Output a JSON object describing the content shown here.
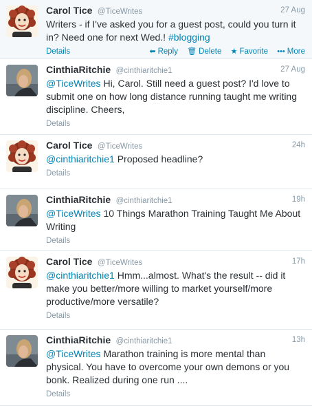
{
  "tweets": [
    {
      "fullname": "Carol Tice",
      "username": "@TiceWrites",
      "time": "27 Aug",
      "text": [
        {
          "t": "Writers - if I've asked you for a guest post, could you turn it in? Need one for next Wed.! "
        },
        {
          "t": "#blogging",
          "k": "hashtag"
        }
      ],
      "details": "Details",
      "actions": {
        "reply": "Reply",
        "delete": "Delete",
        "favorite": "Favorite",
        "more": "More"
      }
    },
    {
      "fullname": "CinthiaRitchie",
      "username": "@cinthiaritchie1",
      "time": "27 Aug",
      "text": [
        {
          "t": "@TiceWrites",
          "k": "mention"
        },
        {
          "t": " Hi, Carol. Still need a guest post? I'd love to submit one on how long distance running taught me writing discipline. Cheers,"
        }
      ],
      "details": "Details"
    },
    {
      "fullname": "Carol Tice",
      "username": "@TiceWrites",
      "time": "24h",
      "text": [
        {
          "t": "@cinthiaritchie1",
          "k": "mention"
        },
        {
          "t": " Proposed headline?"
        }
      ],
      "details": "Details"
    },
    {
      "fullname": "CinthiaRitchie",
      "username": "@cinthiaritchie1",
      "time": "19h",
      "text": [
        {
          "t": "@TiceWrites",
          "k": "mention"
        },
        {
          "t": " 10 Things Marathon Training Taught Me About Writing"
        }
      ],
      "details": "Details"
    },
    {
      "fullname": "Carol Tice",
      "username": "@TiceWrites",
      "time": "17h",
      "text": [
        {
          "t": "@cinthiaritchie1",
          "k": "mention"
        },
        {
          "t": " Hmm...almost. What's the result -- did it make you better/more willing to market yourself/more productive/more versatile?"
        }
      ],
      "details": "Details"
    },
    {
      "fullname": "CinthiaRitchie",
      "username": "@cinthiaritchie1",
      "time": "13h",
      "text": [
        {
          "t": "@TiceWrites",
          "k": "mention"
        },
        {
          "t": " Marathon training is more mental than physical. You have to overcome your own demons or you bonk. Realized during one run ...."
        }
      ],
      "details": "Details"
    }
  ],
  "icons": {
    "reply": "reply-arrow-icon",
    "delete": "trash-icon",
    "favorite": "star-icon",
    "more": "more-dots-icon"
  },
  "colors": {
    "link": "#0084b4",
    "muted": "#8899a6",
    "text": "#292f33",
    "highlight_bg": "#f5f8fa"
  }
}
